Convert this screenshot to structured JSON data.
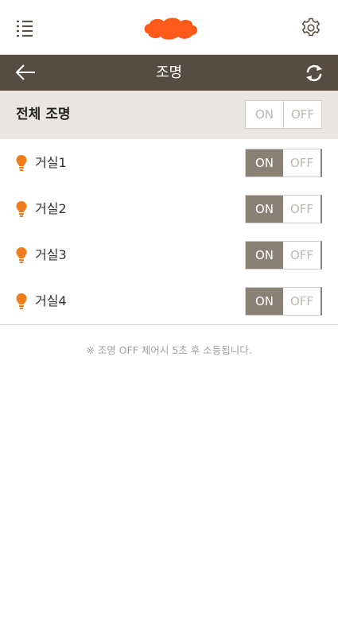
{
  "colors": {
    "brand": "#ff5a1a",
    "title_bar": "#574c3f",
    "toggle_active": "#8a8074",
    "bulb": "#f07d1a"
  },
  "header": {
    "menu_icon": "list-icon",
    "logo_icon": "cloud-logo",
    "settings_icon": "gear-icon"
  },
  "titlebar": {
    "back_icon": "arrow-left-icon",
    "title": "조명",
    "refresh_icon": "refresh-icon"
  },
  "all_lights": {
    "label": "전체 조명",
    "on_label": "ON",
    "off_label": "OFF",
    "state": "none"
  },
  "lights": [
    {
      "label": "거실1",
      "on_label": "ON",
      "off_label": "OFF",
      "state": "on"
    },
    {
      "label": "거실2",
      "on_label": "ON",
      "off_label": "OFF",
      "state": "on"
    },
    {
      "label": "거실3",
      "on_label": "ON",
      "off_label": "OFF",
      "state": "on"
    },
    {
      "label": "거실4",
      "on_label": "ON",
      "off_label": "OFF",
      "state": "on"
    }
  ],
  "notice": "※ 조명 OFF 제어시 5초 후 소등됩니다."
}
